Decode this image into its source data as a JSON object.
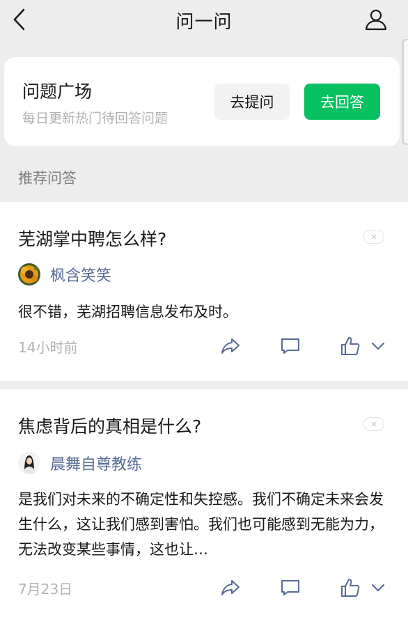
{
  "header": {
    "title": "问一问",
    "back_icon": "chevron-left-icon",
    "profile_icon": "user-icon"
  },
  "question_square": {
    "title": "问题广场",
    "subtitle": "每日更新热门待回答问题",
    "ask_button": "去提问",
    "answer_button": "去回答"
  },
  "section_label": "推荐问答",
  "colors": {
    "accent_green": "#07c160",
    "author_blue": "#576b95",
    "muted_gray": "#b2b2b2",
    "background": "#ededed"
  },
  "feed": [
    {
      "question": "芜湖掌中聘怎么样?",
      "author": "枫含笑笑",
      "avatar_icon": "sunflower-avatar",
      "answer": "很不错，芜湖招聘信息发布及时。",
      "time": "14小时前"
    },
    {
      "question": "焦虑背后的真相是什么?",
      "author": "晨舞自尊教练",
      "avatar_icon": "woman-portrait-avatar",
      "answer": "是我们对未来的不确定性和失控感。我们不确定未来会发生什么，这让我们感到害怕。我们也可能感到无能为力，无法改变某些事情，这也让…",
      "time": "7月23日"
    }
  ]
}
